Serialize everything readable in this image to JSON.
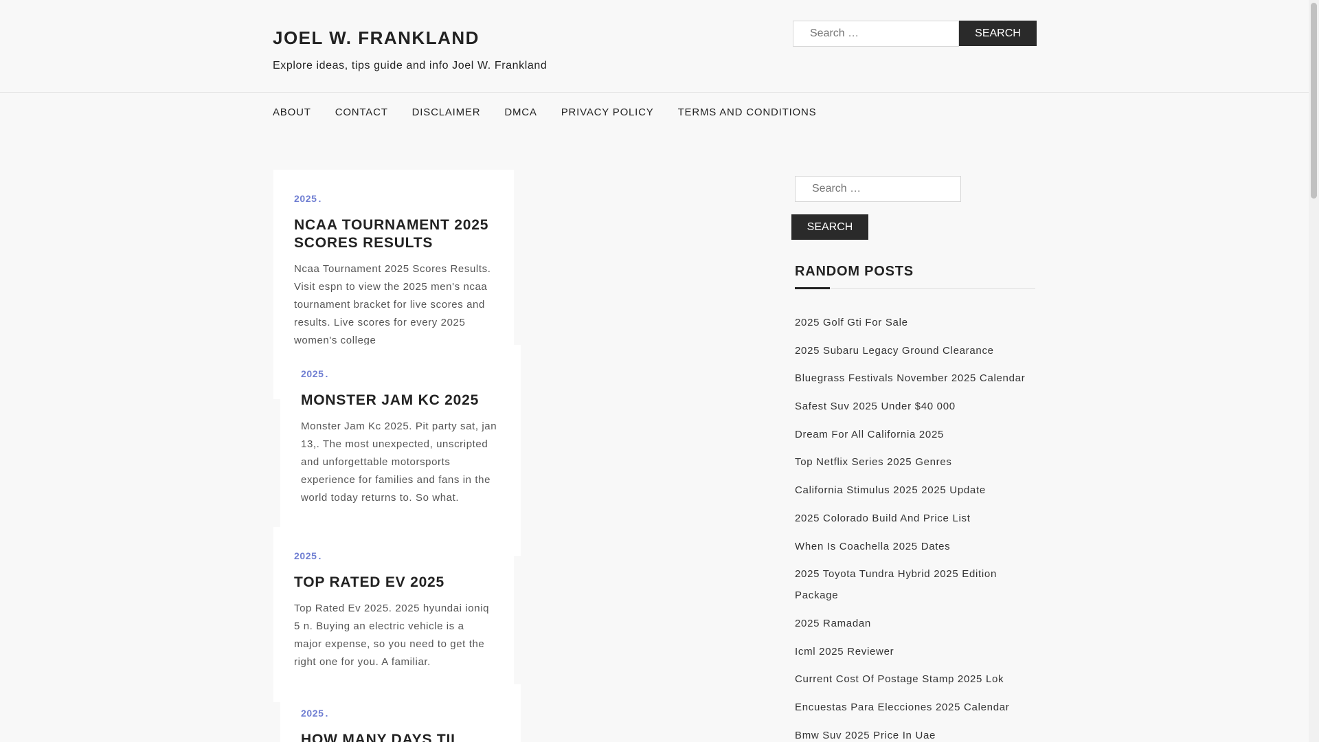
{
  "header": {
    "site_title": "JOEL W. FRANKLAND",
    "site_description": "Explore ideas, tips guide and info Joel W. Frankland",
    "search": {
      "placeholder": "Search …",
      "button_label": "SEARCH"
    }
  },
  "nav": {
    "items": [
      {
        "label": "ABOUT"
      },
      {
        "label": "CONTACT"
      },
      {
        "label": "DISCLAIMER"
      },
      {
        "label": "DMCA"
      },
      {
        "label": "PRIVACY POLICY"
      },
      {
        "label": "TERMS AND CONDITIONS"
      }
    ]
  },
  "posts": [
    {
      "category": "2025",
      "title": "NCAA TOURNAMENT 2025 SCORES RESULTS",
      "excerpt": "Ncaa Tournament 2025 Scores Results. Visit espn to view the 2025 men's ncaa tournament bracket for live scores and results. Live scores for every 2025 women's college"
    },
    {
      "category": "2025",
      "title": "MONSTER JAM KC 2025",
      "excerpt": "Monster Jam Kc 2025. Pit party sat, jan 13,. The most unexpected, unscripted and unforgettable motorsports experience for families and fans in the world today returns to. So what."
    },
    {
      "category": "2025",
      "title": "TOP RATED EV 2025",
      "excerpt": "Top Rated Ev 2025. 2025 hyundai ioniq 5 n. Buying an electric vehicle is a major expense, so you need to get the right one for you. A familiar."
    },
    {
      "category": "2025",
      "title": "HOW MANY DAYS TIL",
      "excerpt": ""
    }
  ],
  "sidebar": {
    "search": {
      "placeholder": "Search …",
      "button_label": "SEARCH"
    },
    "random_posts": {
      "title": "RANDOM POSTS",
      "items": [
        "2025 Golf Gti For Sale",
        "2025 Subaru Legacy Ground Clearance",
        "Bluegrass Festivals November 2025 Calendar",
        "Safest Suv 2025 Under $40 000",
        "Dream For All California 2025",
        "Top Netflix Series 2025 Genres",
        "California Stimulus 2025 2025 Update",
        "2025 Colorado Build And Price List",
        "When Is Coachella 2025 Dates",
        "2025 Toyota Tundra Hybrid 2025 Edition Package",
        "2025 Ramadan",
        "Icml 2025 Reviewer",
        "Current Cost Of Postage Stamp 2025 Lok",
        "Encuestas Para Elecciones 2025 Calendar",
        "Bmw Suv 2025 Price In Uae"
      ]
    }
  },
  "colors": {
    "accent": "#6f7ed2",
    "button_bg": "#2a2a2a",
    "page_bg": "#f8f8f8"
  }
}
